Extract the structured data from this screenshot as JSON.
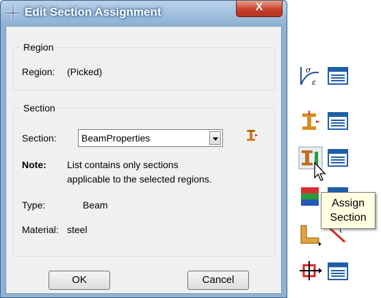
{
  "window": {
    "title": "Edit Section Assignment",
    "close_label": "X"
  },
  "region_group": {
    "legend": "Region",
    "label": "Region:",
    "value": "(Picked)"
  },
  "section_group": {
    "legend": "Section",
    "section_label": "Section:",
    "section_value": "BeamProperties",
    "note_label": "Note:",
    "note_line1": "List contains only sections",
    "note_line2": "applicable to the selected regions.",
    "type_label": "Type:",
    "type_value": "Beam",
    "material_label": "Material:",
    "material_value": "steel"
  },
  "buttons": {
    "ok": "OK",
    "cancel": "Cancel"
  },
  "toolbox": {
    "tooltip_line1": "Assign",
    "tooltip_line2": "Section",
    "icons": [
      "stress-strain-icon",
      "section-manager-icon",
      "create-section-icon",
      "section-manager-icon-2",
      "assign-section-icon",
      "section-assignment-manager-icon",
      "profile-icon",
      "assign-beam-orientation-icon",
      "shell-offset-icon",
      "assign-tangent-icon",
      "inertia-icon",
      "inertia-manager-icon"
    ]
  },
  "colors": {
    "title_bar": "#8eb0d3",
    "close_button": "#c7412a",
    "dialog_background": "#f0f0f0",
    "tooltip_background": "#ffffe1"
  }
}
